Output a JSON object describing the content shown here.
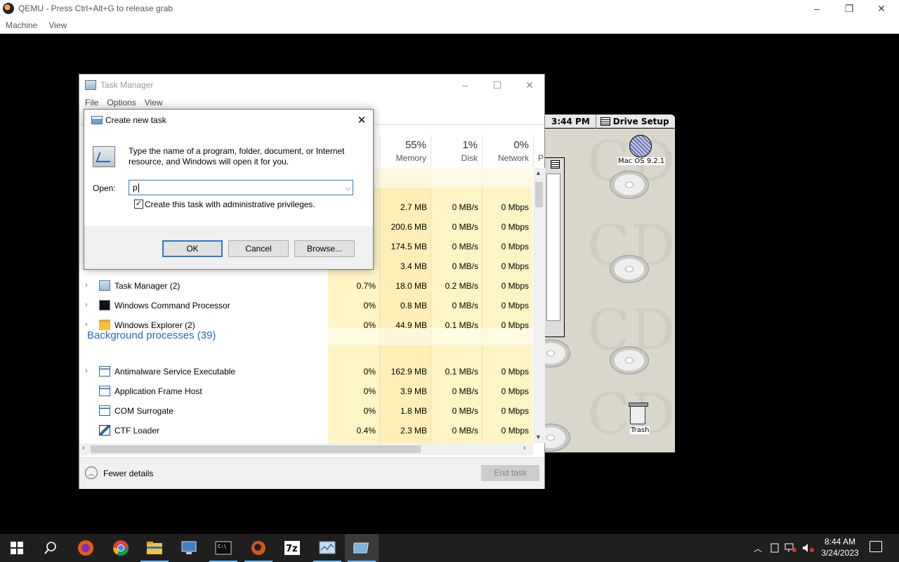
{
  "qemu": {
    "title": "QEMU - Press Ctrl+Alt+G to release grab",
    "menu": [
      "Machine",
      "View"
    ],
    "controls": [
      "–",
      "❐",
      "✕"
    ]
  },
  "mac": {
    "time": "3:44 PM",
    "app": "Drive Setup",
    "hd_label": "Mac OS 9.2.1",
    "trash_label": "Trash"
  },
  "task_manager": {
    "title": "Task Manager",
    "menu": [
      "File",
      "Options",
      "View"
    ],
    "controls": [
      "–",
      "☐",
      "✕"
    ],
    "columns": [
      {
        "pct": "55%",
        "name": "Memory"
      },
      {
        "pct": "1%",
        "name": "Disk"
      },
      {
        "pct": "0%",
        "name": "Network"
      },
      {
        "pct": "",
        "name": "P"
      }
    ],
    "app_rows_partial": [
      {
        "cpu": "",
        "memory": "2.7 MB",
        "disk": "0 MB/s",
        "network": "0 Mbps"
      },
      {
        "cpu": "",
        "memory": "200.6 MB",
        "disk": "0 MB/s",
        "network": "0 Mbps"
      },
      {
        "cpu": "",
        "memory": "174.5 MB",
        "disk": "0 MB/s",
        "network": "0 Mbps"
      },
      {
        "cpu": "",
        "memory": "3.4 MB",
        "disk": "0 MB/s",
        "network": "0 Mbps"
      }
    ],
    "app_rows": [
      {
        "name": "Task Manager (2)",
        "icon": "task-manager-icon",
        "expand": true,
        "cpu": "0.7%",
        "memory": "18.0 MB",
        "disk": "0.2 MB/s",
        "network": "0 Mbps"
      },
      {
        "name": "Windows Command Processor",
        "icon": "cmd-icon",
        "expand": true,
        "cpu": "0%",
        "memory": "0.8 MB",
        "disk": "0 MB/s",
        "network": "0 Mbps"
      },
      {
        "name": "Windows Explorer (2)",
        "icon": "folder-icon",
        "expand": true,
        "cpu": "0%",
        "memory": "44.9 MB",
        "disk": "0.1 MB/s",
        "network": "0 Mbps"
      }
    ],
    "background_header": "Background processes (39)",
    "background_rows": [
      {
        "name": "Antimalware Service Executable",
        "icon": "service-icon",
        "expand": true,
        "cpu": "0%",
        "memory": "162.9 MB",
        "disk": "0.1 MB/s",
        "network": "0 Mbps"
      },
      {
        "name": "Application Frame Host",
        "icon": "service-icon",
        "expand": false,
        "cpu": "0%",
        "memory": "3.9 MB",
        "disk": "0 MB/s",
        "network": "0 Mbps"
      },
      {
        "name": "COM Surrogate",
        "icon": "service-icon",
        "expand": false,
        "cpu": "0%",
        "memory": "1.8 MB",
        "disk": "0 MB/s",
        "network": "0 Mbps"
      },
      {
        "name": "CTF Loader",
        "icon": "pen-icon",
        "expand": false,
        "cpu": "0.4%",
        "memory": "2.3 MB",
        "disk": "0 MB/s",
        "network": "0 Mbps"
      }
    ],
    "fewer_details": "Fewer details",
    "end_task": "End task"
  },
  "dialog": {
    "title": "Create new task",
    "close": "✕",
    "description": "Type the name of a program, folder, document, or Internet resource, and Windows will open it for you.",
    "open_label": "Open:",
    "open_value": "p",
    "admin_checked": true,
    "admin_label": "Create this task with administrative privileges.",
    "ok": "OK",
    "cancel": "Cancel",
    "browse": "Browse..."
  },
  "taskbar": {
    "apps": [
      "start-icon",
      "search-icon",
      "firefox-icon",
      "chrome-icon",
      "file-explorer-icon",
      "remote-desktop-icon",
      "terminal-icon",
      "qemu-icon",
      "7zip-icon",
      "task-manager-icon",
      "run-dialog-icon"
    ],
    "time": "8:44 AM",
    "date": "3/24/2023",
    "accent": "#76b9ed"
  },
  "colors": {
    "heat_light": "#fff4c4",
    "heat_medium": "#ffe9a8",
    "section_blue": "#2a6ab1",
    "focus_blue": "#2c7ac4"
  }
}
